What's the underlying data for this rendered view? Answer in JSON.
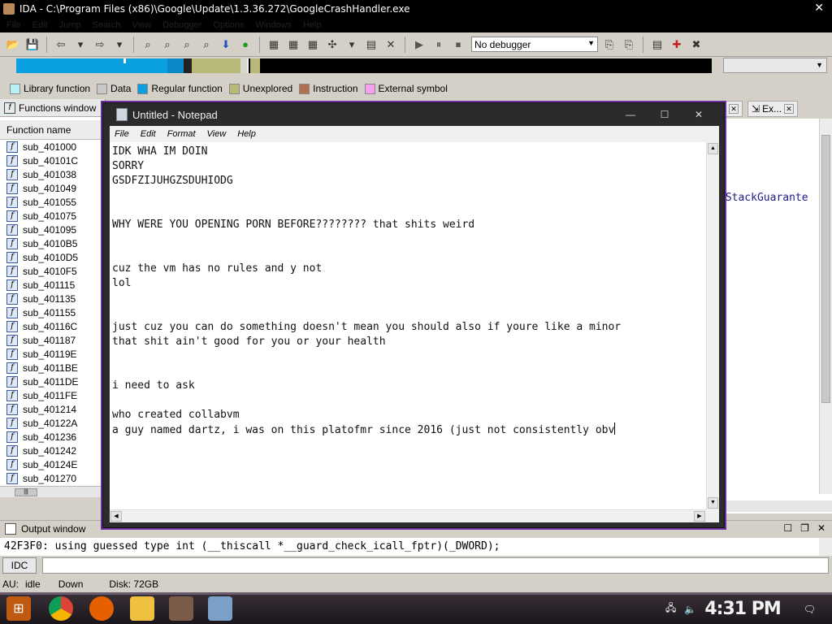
{
  "ida": {
    "title": "IDA - C:\\Program Files (x86)\\Google\\Update\\1.3.36.272\\GoogleCrashHandler.exe",
    "menu": [
      "File",
      "Edit",
      "Jump",
      "Search",
      "View",
      "Debugger",
      "Options",
      "Windows",
      "Help"
    ],
    "debugger_select": "No debugger",
    "legend": [
      {
        "label": "Library function",
        "color": "#b8f0f8"
      },
      {
        "label": "Data",
        "color": "#c8c8c8"
      },
      {
        "label": "Regular function",
        "color": "#0aa0e0"
      },
      {
        "label": "Unexplored",
        "color": "#b8b878"
      },
      {
        "label": "Instruction",
        "color": "#b07050"
      },
      {
        "label": "External symbol",
        "color": "#f8a0f0"
      }
    ],
    "functions_window": {
      "tab_label": "Functions window",
      "column_header": "Function name",
      "functions": [
        "sub_401000",
        "sub_40101C",
        "sub_401038",
        "sub_401049",
        "sub_401055",
        "sub_401075",
        "sub_401095",
        "sub_4010B5",
        "sub_4010D5",
        "sub_4010F5",
        "sub_401115",
        "sub_401135",
        "sub_401155",
        "sub_40116C",
        "sub_401187",
        "sub_40119E",
        "sub_4011BE",
        "sub_4011DE",
        "sub_4011FE",
        "sub_401214",
        "sub_40122A",
        "sub_401236",
        "sub_401242",
        "sub_40124E",
        "sub_401270"
      ]
    },
    "right_panel": {
      "tab_label": "Ex...",
      "code_fragment": "dStackGuarante"
    },
    "output_window": {
      "label": "Output window",
      "line": "42F3F0: using guessed type int (__thiscall *__guard_check_icall_fptr)(_DWORD);",
      "idc_button": "IDC"
    },
    "status": {
      "au": "AU:",
      "state": "idle",
      "direction": "Down",
      "disk": "Disk: 72GB"
    }
  },
  "notepad": {
    "title": "Untitled - Notepad",
    "menu": [
      "File",
      "Edit",
      "Format",
      "View",
      "Help"
    ],
    "lines": [
      "IDK WHA IM DOIN",
      "SORRY",
      "GSDFZIJUHGZSDUHIODG",
      "",
      "",
      "WHY WERE YOU OPENING PORN BEFORE???????? that shits weird",
      "",
      "",
      "cuz the vm has no rules and y not",
      "lol",
      "",
      "",
      "just cuz you can do something doesn't mean you should also if youre like a minor",
      "that shit ain't good for you or your health",
      "",
      "",
      "i need to ask",
      "",
      "who created collabvm",
      "a guy named dartz, i was on this platofmr since 2016 (just not consistently obv"
    ]
  },
  "taskbar": {
    "clock": "4:31 PM"
  }
}
